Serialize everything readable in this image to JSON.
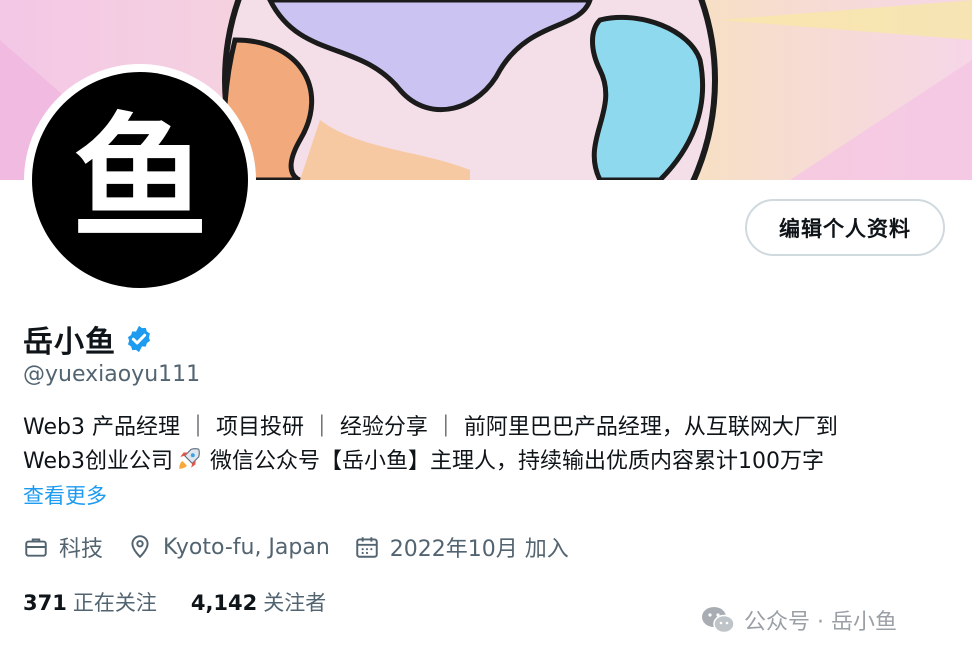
{
  "profile": {
    "avatar_char": "鱼",
    "name": "岳小鱼",
    "handle": "@yuexiaoyu111",
    "edit_button": "编辑个人资料",
    "bio_line1": "Web3 产品经理 ｜ 项目投研 ｜ 经验分享 ｜ 前阿里巴巴产品经理，从互联网大厂到",
    "bio_line2_a": "Web3创业公司",
    "bio_line2_b": " 微信公众号【岳小鱼】主理人，持续输出优质内容累计100万字",
    "show_more": "查看更多",
    "category": "科技",
    "location": "Kyoto-fu, Japan",
    "joined": "2022年10月 加入",
    "following_count": "371",
    "following_label": "正在关注",
    "followers_count": "4,142",
    "followers_label": "关注者"
  },
  "watermark": "公众号 · 岳小鱼",
  "icons": [
    "verified-badge-icon",
    "rocket-icon",
    "briefcase-icon",
    "location-pin-icon",
    "calendar-icon",
    "wechat-icon"
  ],
  "colors": {
    "accent": "#1d9bf0",
    "text": "#0f1419",
    "secondary": "#536471"
  }
}
